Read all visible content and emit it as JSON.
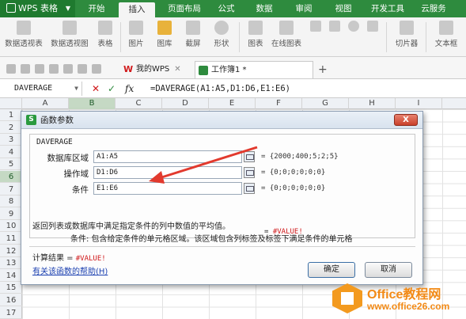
{
  "app": {
    "name": "WPS 表格"
  },
  "tabs": [
    "开始",
    "插入",
    "页面布局",
    "公式",
    "数据",
    "审阅",
    "视图",
    "开发工具",
    "云服务"
  ],
  "active_tab": "插入",
  "ribbon": {
    "items": [
      "数据透视表",
      "数据透视图",
      "表格",
      "图片",
      "图库",
      "截屏",
      "形状",
      "图表",
      "在线图表",
      "切片器",
      "文本框"
    ]
  },
  "doc_tabs": [
    "我的WPS",
    "工作簿1 *"
  ],
  "formula_bar": {
    "name_box": "DAVERAGE",
    "cancel": "✕",
    "confirm": "✓",
    "fx": "fx",
    "formula": "=DAVERAGE(A1:A5,D1:D6,E1:E6)"
  },
  "columns": [
    "A",
    "B",
    "C",
    "D",
    "E",
    "F",
    "G",
    "H",
    "I"
  ],
  "rows": [
    "1",
    "2",
    "3",
    "4",
    "5",
    "6",
    "7",
    "8",
    "9",
    "10",
    "11",
    "12",
    "13",
    "14",
    "15",
    "16",
    "17"
  ],
  "dialog": {
    "title": "函数参数",
    "close": "X",
    "function_name": "DAVERAGE",
    "args": [
      {
        "label": "数据库区域",
        "value": "A1:A5",
        "result": "= {2000;400;5;2;5}"
      },
      {
        "label": "操作域",
        "value": "D1:D6",
        "result": "= {0;0;0;0;0;0}"
      },
      {
        "label": "条件",
        "value": "E1:E6",
        "result": "= {0;0;0;0;0;0}"
      }
    ],
    "result_prefix": "=",
    "result_value": "#VALUE!",
    "description": "返回列表或数据库中满足指定条件的列中数值的平均值。",
    "arg_description": "条件:  包含给定条件的单元格区域。该区域包含列标签及标签下满足条件的单元格",
    "calc_label": "计算结果 =",
    "calc_value": "#VALUE!",
    "help_link": "有关该函数的帮助(H)",
    "ok": "确定",
    "cancel": "取消"
  },
  "watermark": {
    "line1": "Office教程网",
    "line2": "www.office26.com"
  },
  "colors": {
    "accent": "#2e8b3e",
    "error": "#d0191b",
    "watermark": "#f28a16"
  }
}
